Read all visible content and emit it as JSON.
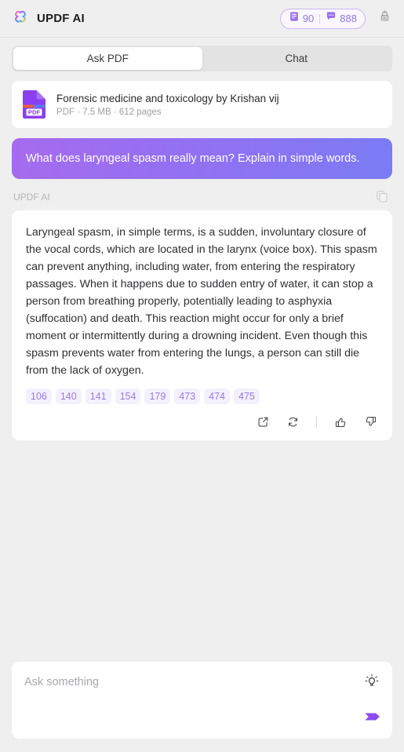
{
  "header": {
    "app_title": "UPDF AI",
    "logo_icon": "updf-clover-logo",
    "doc_credits": "90",
    "chat_credits": "888",
    "doc_icon": "document-icon",
    "chat_icon": "chat-bubble-icon",
    "clear_icon": "brush-clear-icon"
  },
  "tabs": [
    {
      "label": "Ask PDF",
      "active": true
    },
    {
      "label": "Chat",
      "active": false
    }
  ],
  "file": {
    "icon": "pdf-file-icon",
    "name": "Forensic medicine and toxicology  by Krishan vij",
    "meta": "PDF · 7.5 MB · 612 pages"
  },
  "message": {
    "user_text": "What does laryngeal spasm really mean? Explain in simple words.",
    "assistant_name": "UPDF AI",
    "copy_icon": "copy-icon",
    "assistant_text": "Laryngeal spasm, in simple terms, is a sudden, involuntary closure of the vocal cords, which are located in the larynx (voice box). This spasm can prevent anything, including water, from entering the respiratory passages. When it happens due to sudden entry of water, it can stop a person from breathing properly, potentially leading to asphyxia (suffocation) and death. This reaction might occur for only a brief moment or intermittently during a drowning incident. Even though this spasm prevents water from entering the lungs, a person can still die from the lack of oxygen.",
    "citations": [
      "106",
      "140",
      "141",
      "154",
      "179",
      "473",
      "474",
      "475"
    ],
    "actions": [
      {
        "icon": "external-link-icon"
      },
      {
        "icon": "regenerate-icon"
      },
      {
        "icon": "thumbs-up-icon"
      },
      {
        "icon": "thumbs-down-icon"
      }
    ]
  },
  "composer": {
    "placeholder": "Ask something",
    "value": "",
    "bulb_icon": "lightbulb-icon",
    "send_icon": "send-arrow-icon"
  },
  "colors": {
    "accent_purple": "#a66bee",
    "accent_blue": "#7b7bf5",
    "send_purple": "#8c4cf0",
    "chip_text": "#9a7ddd",
    "chip_bg": "#f4f0fd",
    "page_bg": "#efefef"
  }
}
